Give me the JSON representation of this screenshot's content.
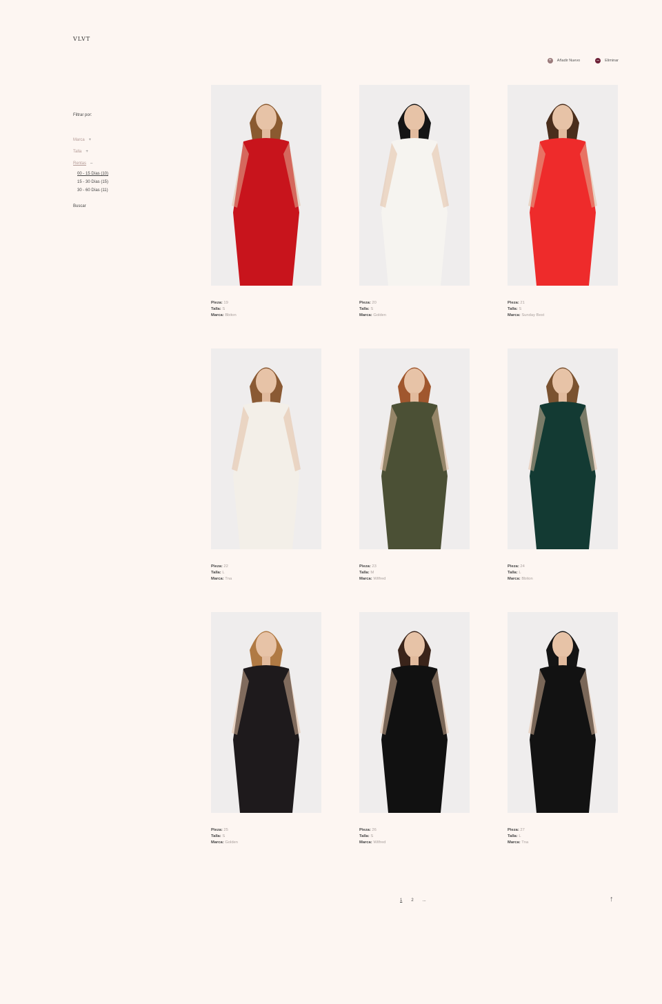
{
  "brand": {
    "logo": "VLVT"
  },
  "actions": {
    "add_label": "Añadir Nuevo",
    "delete_label": "Eliminar"
  },
  "filters": {
    "title": "Filtrar por:",
    "groups": [
      {
        "label": "Marca",
        "sign": "+"
      },
      {
        "label": "Talla",
        "sign": "+"
      },
      {
        "label": "Rentas",
        "sign": "–"
      }
    ],
    "rentals": [
      "00 - 15 Días (10)",
      "15 - 30 Días (15)",
      "30 - 60 Días (11)"
    ],
    "search_label": "Buscar"
  },
  "labels": {
    "piece": "Pieza:",
    "size": "Talla:",
    "brand": "Marca:"
  },
  "products": [
    {
      "piece": "19",
      "size": "S",
      "brand": "Bbiton",
      "dress_color": "#c8141c",
      "hair_color": "#8a5a30"
    },
    {
      "piece": "20",
      "size": "S",
      "brand": "Golden",
      "dress_color": "#f6f4f0",
      "hair_color": "#151515"
    },
    {
      "piece": "21",
      "size": "S",
      "brand": "Sunday Best",
      "dress_color": "#ee2b2b",
      "hair_color": "#4a2e1c"
    },
    {
      "piece": "22",
      "size": "L",
      "brand": "Tna",
      "dress_color": "#f3efe8",
      "hair_color": "#8a5a34"
    },
    {
      "piece": "23",
      "size": "M",
      "brand": "Wilfred",
      "dress_color": "#4b5035",
      "hair_color": "#a0572e"
    },
    {
      "piece": "24",
      "size": "L",
      "brand": "Bbiton",
      "dress_color": "#133a33",
      "hair_color": "#7a5230"
    },
    {
      "piece": "25",
      "size": "S",
      "brand": "Golden",
      "dress_color": "#1e1a1c",
      "hair_color": "#b07a44"
    },
    {
      "piece": "26",
      "size": "S",
      "brand": "Wilfred",
      "dress_color": "#111111",
      "hair_color": "#3a241a"
    },
    {
      "piece": "27",
      "size": "L",
      "brand": "Tna",
      "dress_color": "#121212",
      "hair_color": "#141414"
    }
  ],
  "pagination": {
    "pages": [
      "1",
      "2",
      "..."
    ]
  },
  "back_to_top_icon": "arrow-up-icon"
}
